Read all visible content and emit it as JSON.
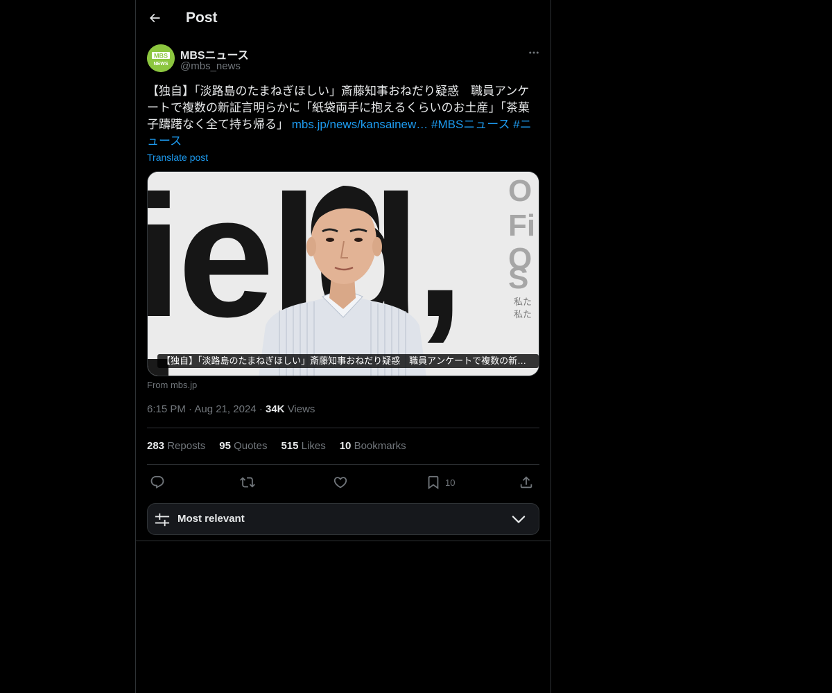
{
  "header": {
    "title": "Post",
    "back_icon": "arrow-left-icon"
  },
  "author": {
    "display_name": "MBSニュース",
    "handle": "@mbs_news",
    "avatar_text_top": "MBS",
    "avatar_text_bottom": "NEWS"
  },
  "post": {
    "text": "【独自】「淡路島のたまねぎほしい」斎藤知事おねだり疑惑　職員アンケートで複数の新証言明らかに「紙袋両手に抱えるくらいのお土産」「茶菓子躊躇なく全て持ち帰る」 ",
    "link": "mbs.jp/news/kansainew…",
    "hashtag1": "#MBSニュース",
    "hashtag2": "#ニュース",
    "translate": "Translate post"
  },
  "media": {
    "caption": "【独自】「淡路島のたまねぎほしい」斎藤知事おねだり疑惑　職員アンケートで複数の新証言明らかに「紙袋両手に抱えるくらいのお土産」",
    "bg_letters": "ield,",
    "right_letters": [
      "O",
      "Fi",
      "O",
      "S"
    ],
    "right_small": [
      "私た",
      "私た"
    ],
    "source": "From mbs.jp"
  },
  "meta": {
    "time": "6:15 PM",
    "date": "Aug 21, 2024",
    "views_count": "34K",
    "views_label": "Views"
  },
  "stats": {
    "reposts_count": "283",
    "reposts_label": "Reposts",
    "quotes_count": "95",
    "quotes_label": "Quotes",
    "likes_count": "515",
    "likes_label": "Likes",
    "bookmarks_count": "10",
    "bookmarks_label": "Bookmarks"
  },
  "actions": {
    "bookmark_count": "10"
  },
  "sort": {
    "label": "Most relevant"
  },
  "colors": {
    "background": "#000000",
    "text": "#e7e9ea",
    "muted": "#71767b",
    "link": "#1d9bf0",
    "border": "#2f3336",
    "avatar": "#8cc63f"
  }
}
